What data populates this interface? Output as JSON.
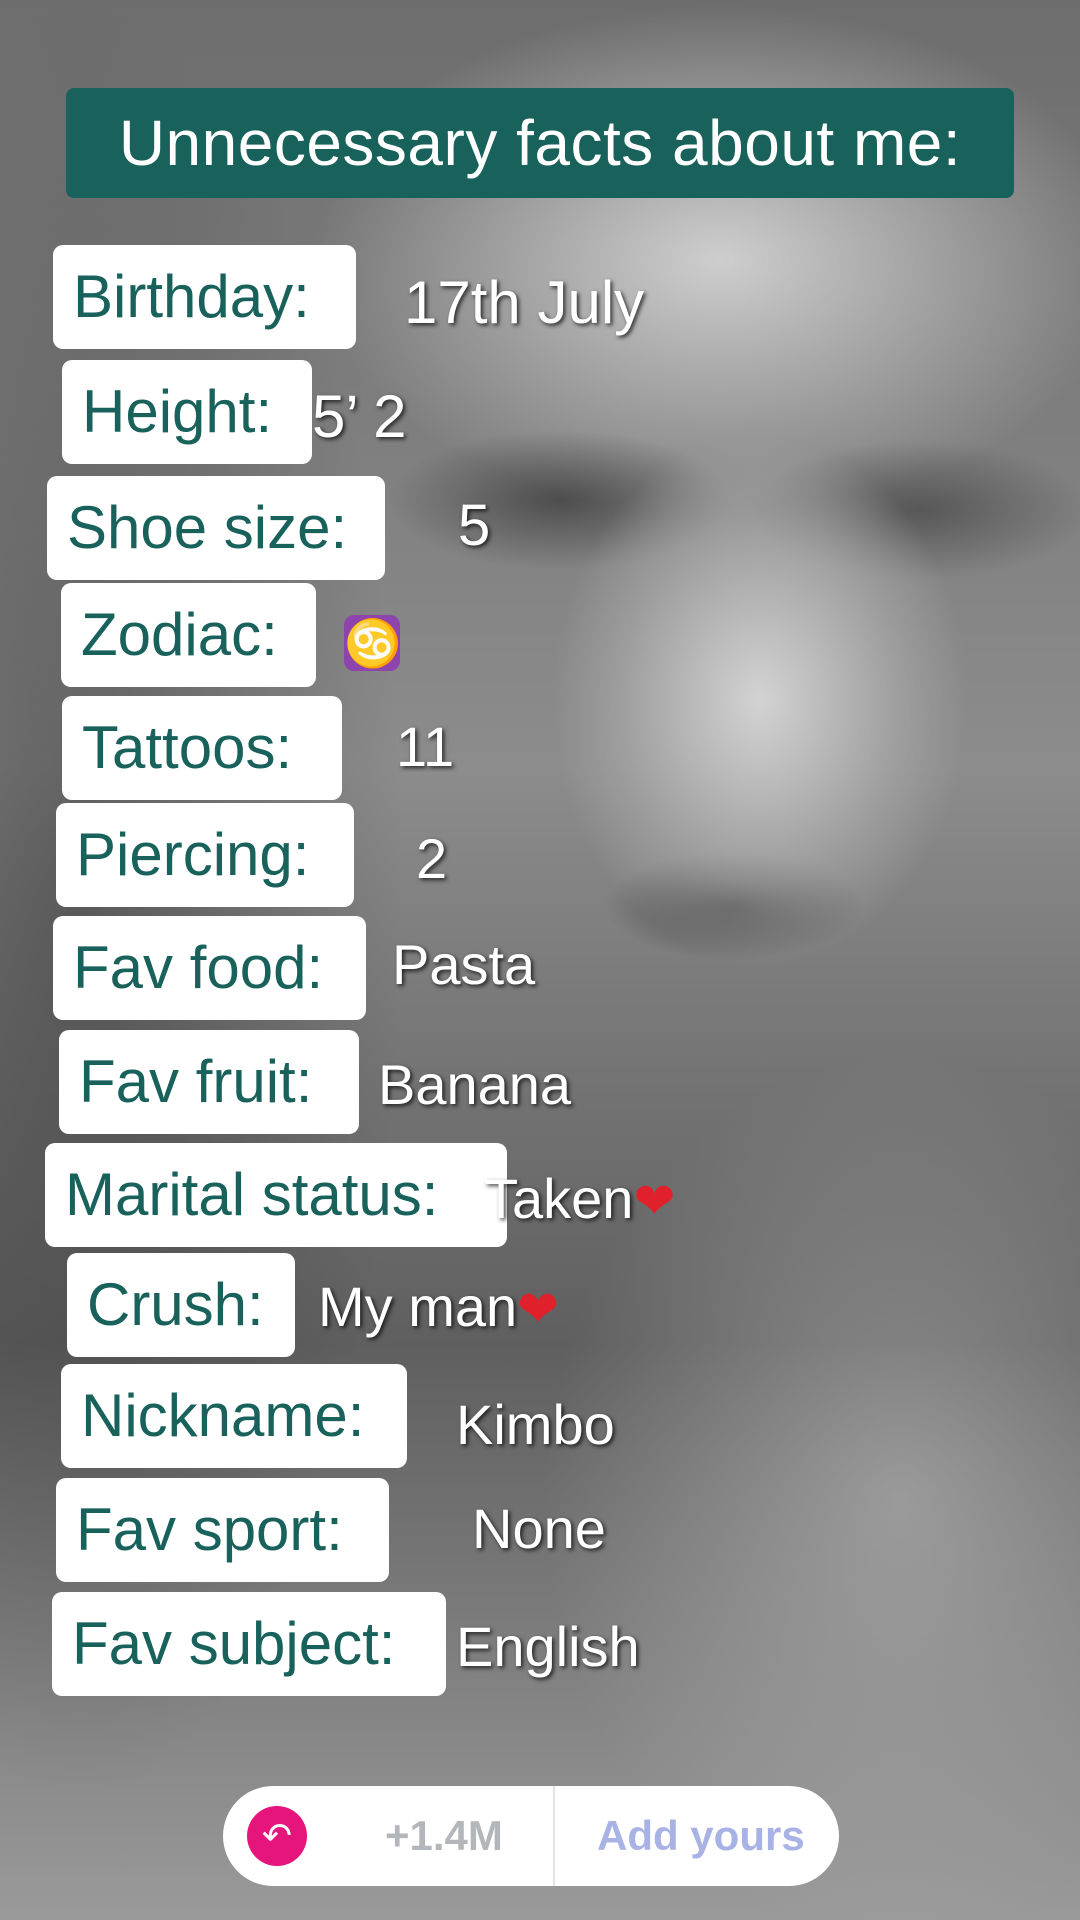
{
  "title": "Unnecessary facts about me:",
  "facts": [
    {
      "label": "Birthday:",
      "value": "17th July"
    },
    {
      "label": "Height:",
      "value": "5’ 2"
    },
    {
      "label": "Shoe size:",
      "value": "5"
    },
    {
      "label": "Zodiac:",
      "value": "♋"
    },
    {
      "label": "Tattoos:",
      "value": "11"
    },
    {
      "label": "Piercing:",
      "value": "2"
    },
    {
      "label": "Fav food:",
      "value": "Pasta"
    },
    {
      "label": "Fav fruit:",
      "value": "Banana"
    },
    {
      "label": "Marital status:",
      "value": "Taken",
      "emoji": "❤"
    },
    {
      "label": "Crush:",
      "value": "My man",
      "emoji": "❤"
    },
    {
      "label": "Nickname:",
      "value": "Kimbo"
    },
    {
      "label": "Fav sport:",
      "value": "None"
    },
    {
      "label": "Fav subject:",
      "value": "English"
    }
  ],
  "sticker": {
    "reply_icon": "↶",
    "count": "+1.4M",
    "add_label": "Add yours"
  },
  "colors": {
    "accent": "#19615b",
    "reply_button": "#e5157b",
    "add_yours": "#a9b2e5"
  }
}
